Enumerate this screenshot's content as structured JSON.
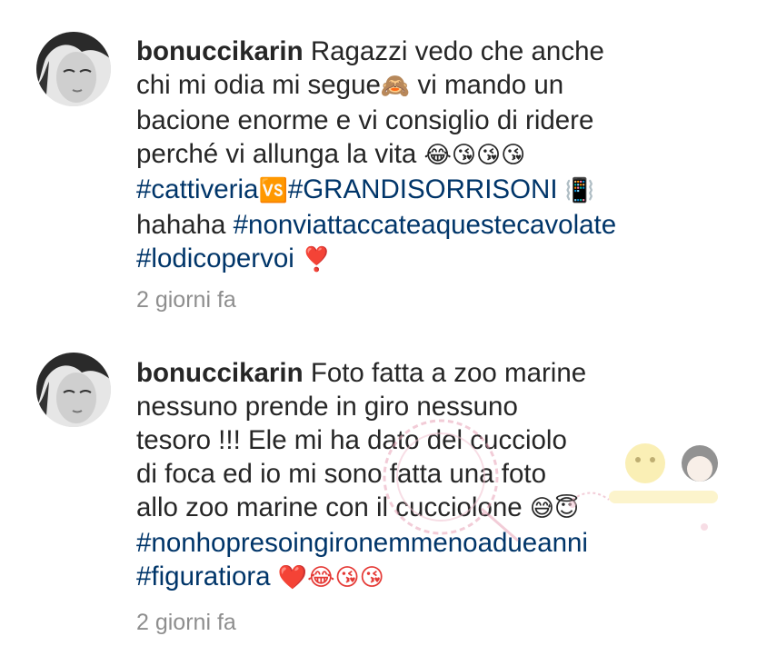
{
  "comments": [
    {
      "username": "bonuccikarin",
      "lines": [
        [
          {
            "t": "text",
            "v": "Ragazzi vedo che anche"
          }
        ],
        [
          {
            "t": "text",
            "v": "chi mi odia mi segue"
          },
          {
            "t": "emoji",
            "v": "🙈"
          },
          {
            "t": "text",
            "v": " vi mando un"
          }
        ],
        [
          {
            "t": "text",
            "v": "bacione enorme e vi consiglio di ridere"
          }
        ],
        [
          {
            "t": "text",
            "v": "perché vi allunga la vita "
          },
          {
            "t": "emoji",
            "v": "😂😘😘😘"
          }
        ],
        [
          {
            "t": "tag",
            "v": "#cattiveria"
          },
          {
            "t": "emoji",
            "v": "🆚"
          },
          {
            "t": "tag",
            "v": "#GRANDISORRISONI"
          },
          {
            "t": "text",
            "v": " "
          },
          {
            "t": "emoji",
            "v": "📳"
          }
        ],
        [
          {
            "t": "text",
            "v": "hahaha "
          },
          {
            "t": "tag",
            "v": "#nonviattaccateaquestecavolate"
          }
        ],
        [
          {
            "t": "tag",
            "v": "#lodicopervoi"
          },
          {
            "t": "text",
            "v": " "
          },
          {
            "t": "emoji",
            "v": "❣️"
          }
        ]
      ],
      "timestamp": "2 giorni fa"
    },
    {
      "username": "bonuccikarin",
      "lines": [
        [
          {
            "t": "text",
            "v": "Foto fatta a zoo marine"
          }
        ],
        [
          {
            "t": "text",
            "v": "nessuno prende in giro nessuno"
          }
        ],
        [
          {
            "t": "text",
            "v": "tesoro !!! Ele mi ha dato del cucciolo"
          }
        ],
        [
          {
            "t": "text",
            "v": "di foca ed io mi sono fatta una foto"
          }
        ],
        [
          {
            "t": "text",
            "v": "allo zoo marine con il cucciolone "
          },
          {
            "t": "emoji",
            "v": "😅😇"
          }
        ],
        [
          {
            "t": "tag",
            "v": "#nonhopresoingironemmenoadueanni"
          }
        ],
        [
          {
            "t": "tag",
            "v": "#figuratiora"
          },
          {
            "t": "text",
            "v": " "
          },
          {
            "t": "emoji",
            "v": "❤️😂😘😘"
          }
        ]
      ],
      "timestamp": "2 giorni fa"
    }
  ],
  "colors": {
    "text": "#262626",
    "hashtag": "#003569",
    "timestamp": "#8e8e8e"
  }
}
